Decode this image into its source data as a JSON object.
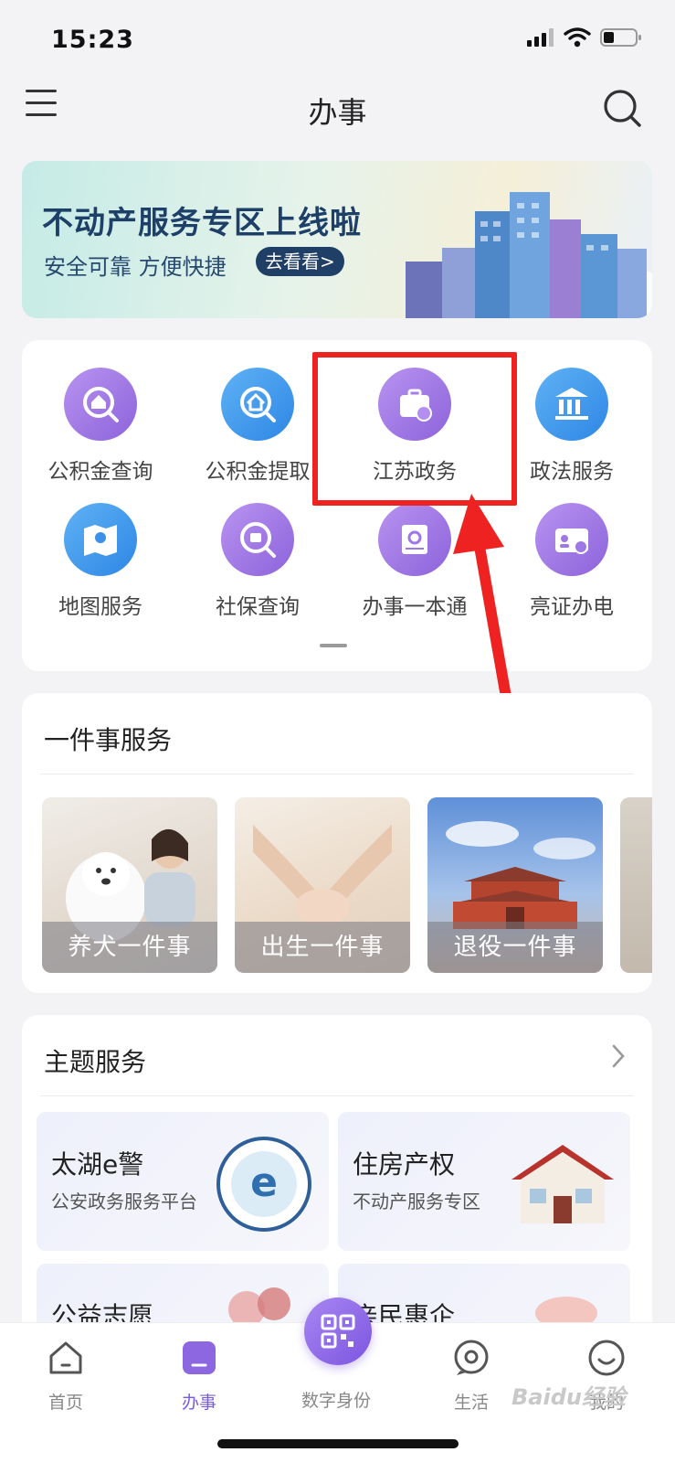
{
  "status_bar": {
    "time": "15:23"
  },
  "nav": {
    "title": "办事"
  },
  "banner": {
    "title": "不动产服务专区上线啦",
    "subtitle": "安全可靠 方便快捷",
    "button": "去看看>"
  },
  "service_grid": {
    "items": [
      {
        "label": "公积金查询",
        "icon": "housing-fund-query-icon"
      },
      {
        "label": "公积金提取",
        "icon": "housing-fund-withdraw-icon"
      },
      {
        "label": "江苏政务",
        "icon": "briefcase-icon"
      },
      {
        "label": "政法服务",
        "icon": "courthouse-icon"
      },
      {
        "label": "地图服务",
        "icon": "map-pin-icon"
      },
      {
        "label": "社保查询",
        "icon": "social-security-icon"
      },
      {
        "label": "办事一本通",
        "icon": "guidebook-icon"
      },
      {
        "label": "亮证办电",
        "icon": "id-card-icon"
      }
    ]
  },
  "one_service": {
    "title": "一件事服务",
    "tiles": [
      {
        "label": "养犬一件事"
      },
      {
        "label": "出生一件事"
      },
      {
        "label": "退役一件事"
      }
    ]
  },
  "theme_service": {
    "title": "主题服务",
    "tiles": [
      {
        "title": "太湖e警",
        "subtitle": "公安政务服务平台"
      },
      {
        "title": "住房产权",
        "subtitle": "不动产服务专区"
      },
      {
        "title": "公益志愿",
        "subtitle": ""
      },
      {
        "title": "亲民惠企",
        "subtitle": ""
      }
    ]
  },
  "tabbar": {
    "tabs": [
      {
        "label": "首页",
        "active": false
      },
      {
        "label": "办事",
        "active": true
      },
      {
        "label": "数字身份",
        "active": false
      },
      {
        "label": "生活",
        "active": false
      },
      {
        "label": "我的",
        "active": false
      }
    ]
  },
  "watermark": "Baidu经验",
  "colors": {
    "accent": "#7a5ae0",
    "highlight": "#ef2222"
  }
}
